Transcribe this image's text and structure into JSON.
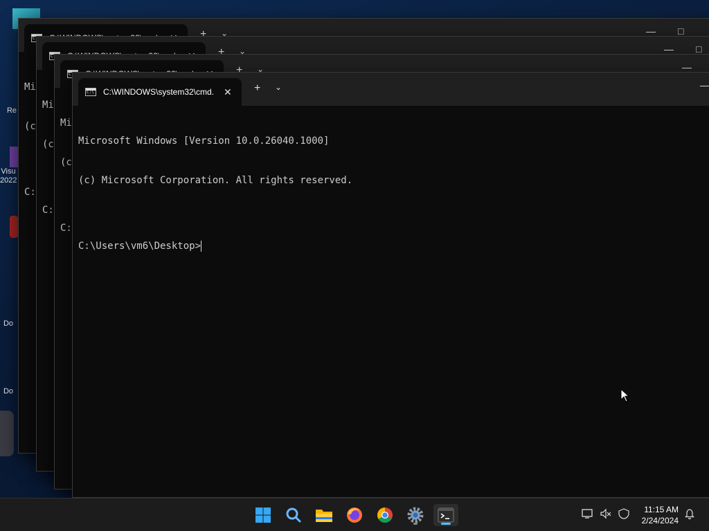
{
  "desktop": {
    "icons": [
      {
        "label": "Re"
      },
      {
        "label": "Visu 2022"
      },
      {
        "label": "Do"
      },
      {
        "label": "Do"
      }
    ]
  },
  "windows": [
    {
      "tab_title": "C:\\WINDOWS\\system32\\cmd.",
      "console_lines": [
        "Mi",
        "(c",
        "",
        "C:"
      ]
    },
    {
      "tab_title": "C:\\WINDOWS\\system32\\cmd.",
      "console_lines": [
        "Mi",
        "(c",
        "",
        "C:"
      ]
    },
    {
      "tab_title": "C:\\WINDOWS\\system32\\cmd.",
      "console_lines": [
        "Mi",
        "(c",
        "",
        "C:"
      ]
    },
    {
      "tab_title": "C:\\WINDOWS\\system32\\cmd.",
      "console_lines": [
        "Microsoft Windows [Version 10.0.26040.1000]",
        "(c) Microsoft Corporation. All rights reserved.",
        ""
      ],
      "prompt": "C:\\Users\\vm6\\Desktop>"
    }
  ],
  "window_controls": {
    "new_tab": "+",
    "dropdown": "⌄",
    "minimize": "—",
    "maximize": "□",
    "close_tab": "✕"
  },
  "taskbar": {
    "icons": [
      "windows-start-icon",
      "search-icon",
      "file-explorer-icon",
      "firefox-icon",
      "chrome-icon",
      "settings-icon",
      "terminal-icon"
    ],
    "clock_time": "11:15 AM",
    "clock_date": "2/24/2024"
  },
  "colors": {
    "accent": "#4cc2ff",
    "console_bg": "#0c0c0c",
    "titlebar": "#202020"
  }
}
